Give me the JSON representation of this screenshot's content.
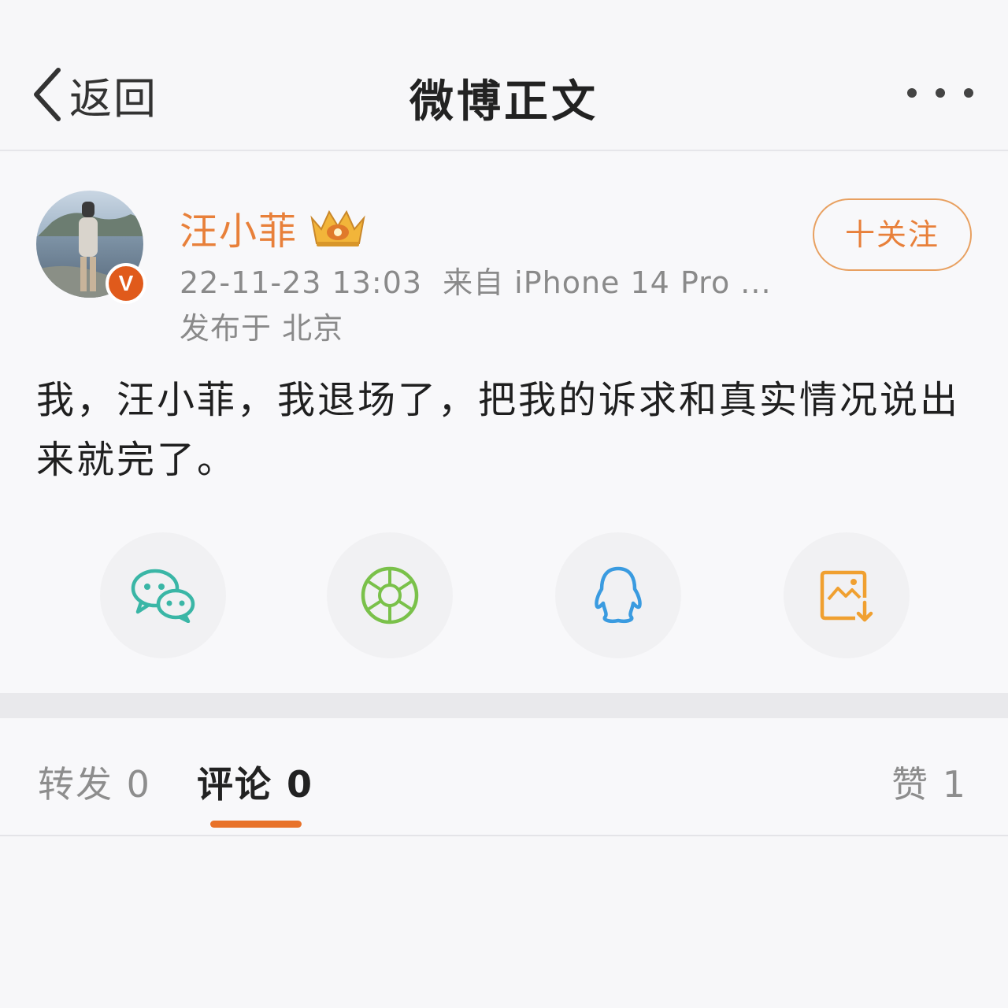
{
  "nav": {
    "back_label": "返回",
    "title": "微博正文"
  },
  "post": {
    "username": "汪小菲",
    "verified_badge": "V",
    "datetime": "22-11-23 13:03",
    "source": "来自 iPhone 14 Pro ...",
    "location": "发布于 北京",
    "follow_label": "十关注",
    "content": "我，汪小菲，我退场了，把我的诉求和真实情况说出来就完了。"
  },
  "share": {
    "items": [
      {
        "icon": "wechat-icon",
        "color": "#3ab6a6"
      },
      {
        "icon": "moments-icon",
        "color": "#7ac14a"
      },
      {
        "icon": "qq-icon",
        "color": "#3a9be0"
      },
      {
        "icon": "save-image-icon",
        "color": "#f0a030"
      }
    ]
  },
  "tabs": {
    "repost": "转发 0",
    "comment": "评论 0",
    "like": "赞 1"
  },
  "colors": {
    "accent": "#e8722a",
    "username": "#e8803a",
    "verified": "#e05a1b"
  }
}
